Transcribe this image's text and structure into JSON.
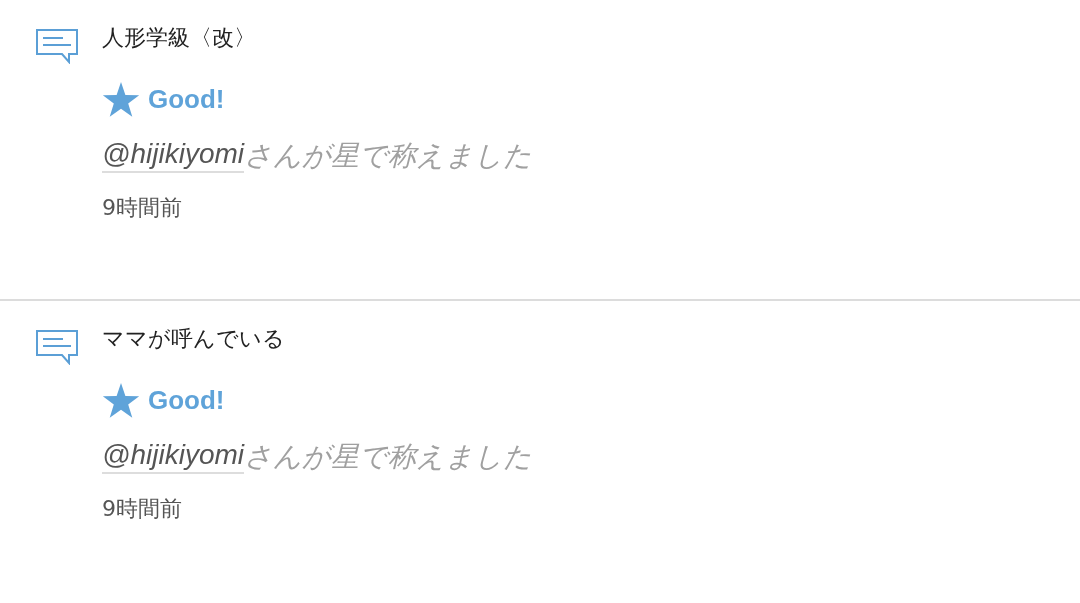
{
  "notifications": [
    {
      "title": "人形学級〈改〉",
      "badge": "Good!",
      "user": "@hijikiyomi",
      "message": "さんが星で称えました",
      "time": "9時間前"
    },
    {
      "title": "ママが呼んでいる",
      "badge": "Good!",
      "user": "@hijikiyomi",
      "message": "さんが星で称えました",
      "time": "9時間前"
    }
  ]
}
